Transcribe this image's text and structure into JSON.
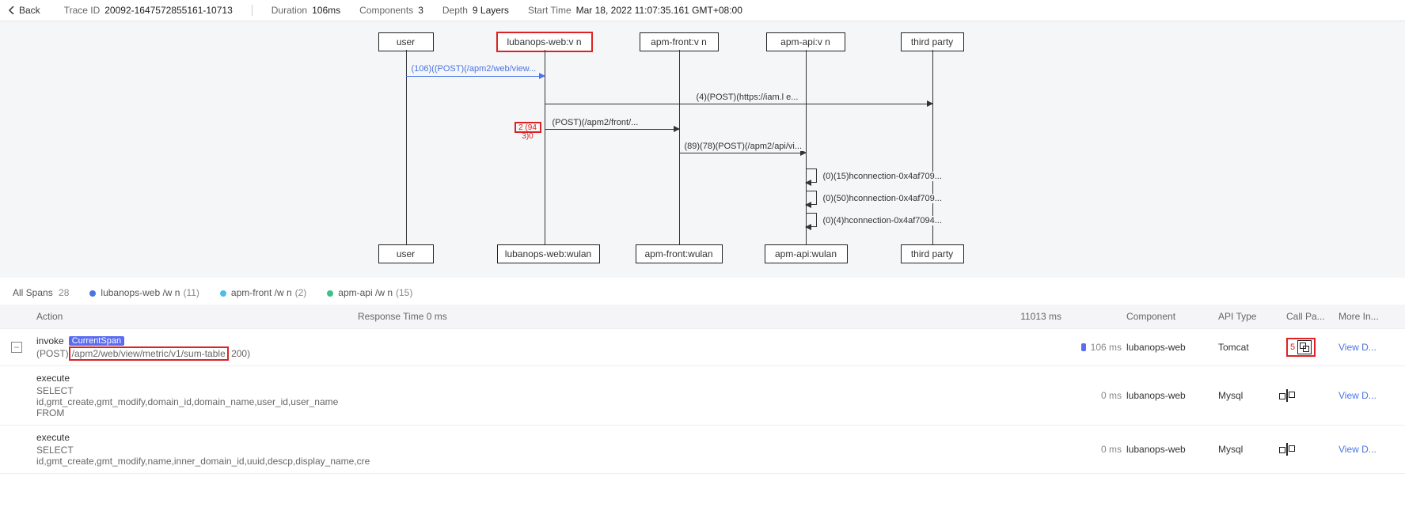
{
  "header": {
    "back": "Back",
    "trace_id_label": "Trace ID",
    "trace_id": "20092-1647572855161-10713",
    "duration_label": "Duration",
    "duration": "106ms",
    "components_label": "Components",
    "components": "3",
    "depth_label": "Depth",
    "depth": "9 Layers",
    "start_time_label": "Start Time",
    "start_time": "Mar 18, 2022 11:07:35.161 GMT+08:00"
  },
  "diagram": {
    "top_nodes": [
      "user",
      "lubanops-web:v     n",
      "apm-front:v     n",
      "apm-api:v     n",
      "third party"
    ],
    "bottom_nodes": [
      "user",
      "lubanops-web:wulan",
      "apm-front:wulan",
      "apm-api:wulan",
      "third party"
    ],
    "msgs": {
      "m1": "(106)((POST)(/apm2/web/view...",
      "m2": "(4)(POST)(https://iam.l      e...",
      "m3_red": "2 (94 3)0",
      "m3": "(POST)(/apm2/front/...",
      "m4": "(89)(78)(POST)(/apm2/api/vi...",
      "s1": "(0)(15)hconnection-0x4af709...",
      "s2": "(0)(50)hconnection-0x4af709...",
      "s3": "(0)(4)hconnection-0x4af7094..."
    }
  },
  "legend": {
    "all_spans_label": "All Spans",
    "all_spans_count": "28",
    "items": [
      {
        "color": "#4a74e6",
        "name": "lubanops-web /w    n",
        "count": "(11)"
      },
      {
        "color": "#4fbde8",
        "name": "apm-front /w    n",
        "count": "(2)"
      },
      {
        "color": "#38c488",
        "name": "apm-api /w    n",
        "count": "(15)"
      }
    ]
  },
  "table": {
    "headers": {
      "action": "Action",
      "response": "Response Time 0 ms",
      "response_max": "11013 ms",
      "component": "Component",
      "api_type": "API Type",
      "call_pa": "Call Pa...",
      "more": "More In..."
    },
    "rows": [
      {
        "expand": "−",
        "title": "invoke",
        "current_span": "CurrentSpan",
        "detail_prefix": "(POST)",
        "detail_boxed": "/apm2/web/view/metric/v1/sum-table",
        "detail_suffix": " 200)",
        "rt": "106 ms",
        "show_bar": true,
        "component": "lubanops-web",
        "api": "Tomcat",
        "callpa_boxed": true,
        "callpa_count": "5",
        "more": "View D..."
      },
      {
        "expand": "",
        "title": "execute",
        "current_span": "",
        "detail_prefix": "SELECT id,gmt_create,gmt_modify,domain_id,domain_name,user_id,user_name FROM",
        "detail_boxed": "",
        "detail_suffix": "",
        "rt": "0 ms",
        "show_bar": false,
        "component": "lubanops-web",
        "api": "Mysql",
        "callpa_boxed": false,
        "callpa_count": "",
        "more": "View D..."
      },
      {
        "expand": "",
        "title": "execute",
        "current_span": "",
        "detail_prefix": "SELECT id,gmt_create,gmt_modify,name,inner_domain_id,uuid,descp,display_name,cre",
        "detail_boxed": "",
        "detail_suffix": "",
        "rt": "0 ms",
        "show_bar": false,
        "component": "lubanops-web",
        "api": "Mysql",
        "callpa_boxed": false,
        "callpa_count": "",
        "more": "View D..."
      }
    ]
  }
}
